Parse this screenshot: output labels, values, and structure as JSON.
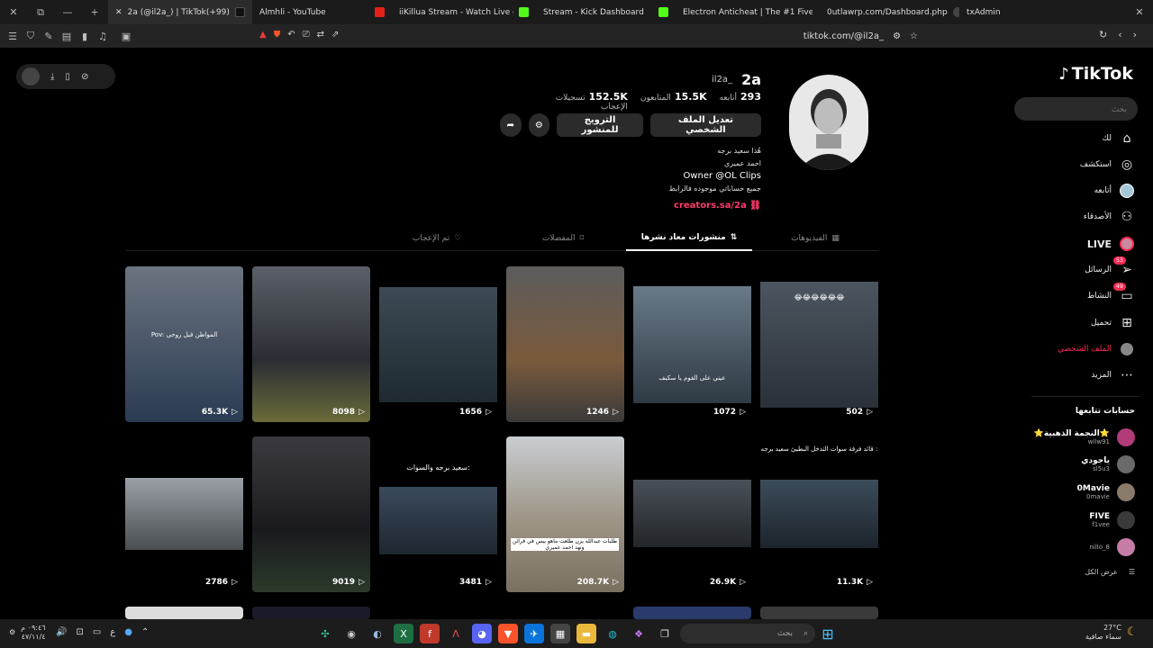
{
  "browser": {
    "tabs": [
      {
        "label": "2a (@il2a_) | TikTok(+99)",
        "active": true
      },
      {
        "label": "Almhli - YouTube"
      },
      {
        "label": "iiKillua Stream - Watch Live on K"
      },
      {
        "label": "Stream - Kick Dashboard"
      },
      {
        "label": "Electron Anticheat | The #1 FiveM A"
      },
      {
        "label": "0utlawrp.com/Dashboard.php"
      },
      {
        "label": "txAdmin"
      }
    ],
    "url": "tiktok.com/@il2a_"
  },
  "sidebar": {
    "logo": "TikTok",
    "search_placeholder": "بحث",
    "nav": [
      {
        "label": "لك",
        "icon": "home-icon"
      },
      {
        "label": "استكشف",
        "icon": "compass-icon"
      },
      {
        "label": "أتابعه",
        "icon": "following-avatar-icon"
      },
      {
        "label": "الأصدقاء",
        "icon": "friends-icon"
      },
      {
        "label": "LIVE",
        "icon": "live-icon"
      },
      {
        "label": "الرسائل",
        "icon": "messages-icon",
        "badge": "53"
      },
      {
        "label": "النشاط",
        "icon": "activity-icon",
        "badge": "49"
      },
      {
        "label": "تحميل",
        "icon": "upload-icon"
      },
      {
        "label": "الملف الشخصي",
        "icon": "profile-icon"
      },
      {
        "label": "المزيد",
        "icon": "more-icon"
      }
    ],
    "following_title": "حسابات تتابعها",
    "following": [
      {
        "name": "⭐النجمة الذهبية⭐",
        "user": "wllw91",
        "color": "#b23b7a"
      },
      {
        "name": "ياجودي",
        "user": "sl5u3",
        "color": "#6a6a6a"
      },
      {
        "name": "0Mavie",
        "user": "0mavie",
        "color": "#8a7a6a"
      },
      {
        "name": "FIVE",
        "user": "f1vee",
        "color": "#3a3a3a"
      },
      {
        "name": "",
        "user": "nillo_8",
        "color": "#c77ca8"
      }
    ],
    "see_all": "عرض الكل"
  },
  "profile": {
    "username": "2a",
    "nickname": "_il2a",
    "stats": [
      {
        "value": "293",
        "label": "أتابعه"
      },
      {
        "value": "15.5K",
        "label": "المتابعون"
      },
      {
        "value": "152.5K",
        "label": "تسجيلات الإعجاب"
      }
    ],
    "edit_button": "تعديل الملف الشخصي",
    "promote_button": "الترويج للمنشور",
    "bio": [
      "هُذا سعيد برجه",
      "احمد عميري",
      "Owner @OL Clips",
      "جميع حساباتي موجوده فالرابط"
    ],
    "link": "creators.sa/2a"
  },
  "tabs": [
    {
      "label": "الفيديوهات",
      "active": false
    },
    {
      "label": "منشورات معاد نشرها",
      "active": true
    },
    {
      "label": "المفضلات",
      "active": false
    },
    {
      "label": "تم الإعجاب",
      "active": false
    }
  ],
  "videos": [
    {
      "views": "65.3K",
      "caption": "Pov: المواطن قبل روحي",
      "tone": "#4a5360"
    },
    {
      "views": "8098",
      "caption": "",
      "tone": "#3c4148"
    },
    {
      "views": "1656",
      "caption": "",
      "tone": "#2f3d45"
    },
    {
      "views": "1246",
      "caption": "",
      "tone": "#5a4a3c"
    },
    {
      "views": "1072",
      "caption": "عيني على القوم يا سكيف",
      "tone": "#4a5660"
    },
    {
      "views": "502",
      "caption": "😂😂😂😂😂😂",
      "tone": "#3d4650"
    },
    {
      "views": "2786",
      "caption": "",
      "tone": "#6a6f74"
    },
    {
      "views": "9019",
      "caption": "",
      "tone": "#2e2f34"
    },
    {
      "views": "3481",
      "caption": "سعيد برجه والسوات:",
      "tone": "#2d3a4a"
    },
    {
      "views": "208.7K",
      "caption": "طلبات عبدالله يزن طلعت ماهو يبس في قرائن ونهد احمد عميري",
      "tone": "#8c8578"
    },
    {
      "views": "26.9K",
      "caption": "",
      "tone": "#3a3f44"
    },
    {
      "views": "11.3K",
      "caption": "قائد فرقة سوات التدخل البطيئ سعيد برجه :",
      "tone": "#33414c"
    }
  ],
  "taskbar": {
    "search_placeholder": "بحث",
    "time": "٠٩:٤٦ م",
    "date": "٤٧/١١/٤",
    "weather_temp": "27°C",
    "weather_desc": "سماء صافية",
    "lang": "ع"
  }
}
